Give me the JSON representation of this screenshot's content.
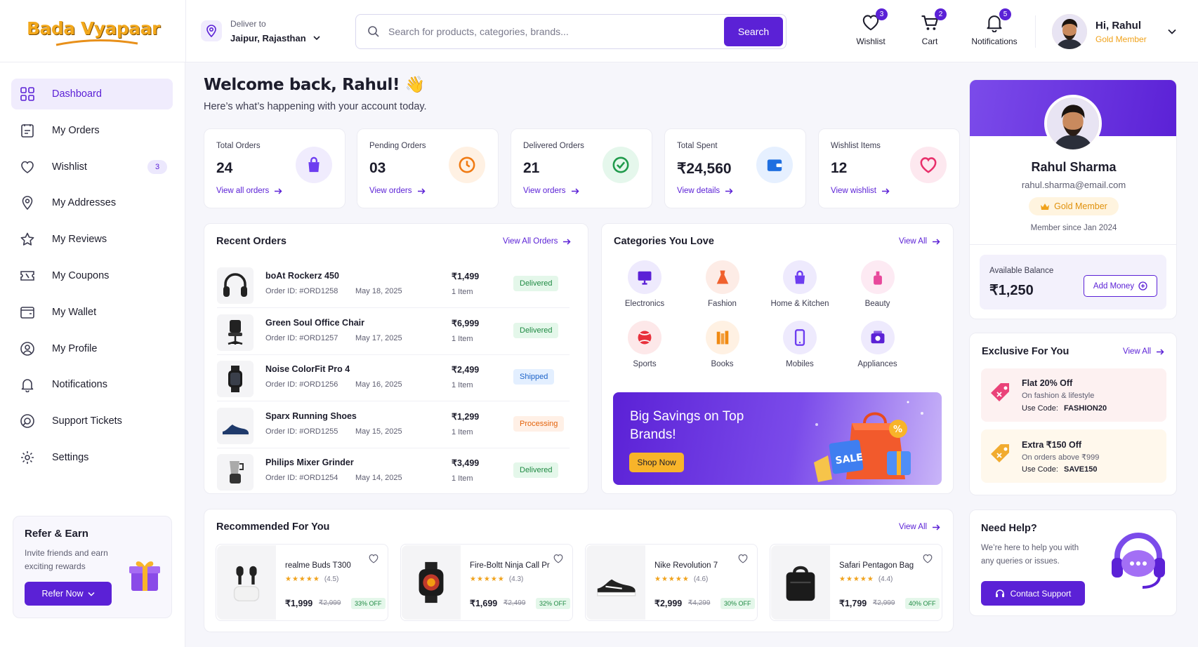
{
  "brand": {
    "logo_text": "Bada Vyapaar"
  },
  "deliver": {
    "label": "Deliver to",
    "location": "Jaipur, Rajasthan"
  },
  "search": {
    "placeholder": "Search for products, categories, brands...",
    "button": "Search"
  },
  "header_icons": [
    {
      "label": "Wishlist",
      "badge": "3",
      "icon": "heart-icon"
    },
    {
      "label": "Cart",
      "badge": "2",
      "icon": "cart-icon"
    },
    {
      "label": "Notifications",
      "badge": "5",
      "icon": "bell-icon"
    }
  ],
  "user": {
    "greeting": "Hi, Rahul",
    "tier": "Gold Member"
  },
  "sidebar": {
    "items": [
      {
        "label": "Dashboard",
        "icon": "grid-icon",
        "active": true
      },
      {
        "label": "My Orders",
        "icon": "orders-icon"
      },
      {
        "label": "Wishlist",
        "icon": "heart-icon",
        "count": "3"
      },
      {
        "label": "My Addresses",
        "icon": "location-pin-icon"
      },
      {
        "label": "My Reviews",
        "icon": "star-icon"
      },
      {
        "label": "My Coupons",
        "icon": "coupon-icon"
      },
      {
        "label": "My Wallet",
        "icon": "wallet-icon"
      },
      {
        "label": "My Profile",
        "icon": "user-icon"
      },
      {
        "label": "Notifications",
        "icon": "bell-icon"
      },
      {
        "label": "Support Tickets",
        "icon": "support-icon"
      },
      {
        "label": "Settings",
        "icon": "settings-icon"
      }
    ],
    "refer": {
      "title": "Refer & Earn",
      "text": "Invite friends and earn exciting rewards",
      "button": "Refer Now"
    }
  },
  "welcome": {
    "title": "Welcome back, Rahul! 👋",
    "subtitle": "Here’s what’s happening with your account today."
  },
  "stats": [
    {
      "label": "Total Orders",
      "value": "24",
      "link": "View all orders",
      "icon": "bag-icon",
      "color": "#6d3df0",
      "bg": "#f0ecfd"
    },
    {
      "label": "Pending Orders",
      "value": "03",
      "link": "View orders",
      "icon": "clock-icon",
      "color": "#f07a12",
      "bg": "#fff1e3"
    },
    {
      "label": "Delivered Orders",
      "value": "21",
      "link": "View orders",
      "icon": "check-circle-icon",
      "color": "#1f9a4b",
      "bg": "#e5f7ec"
    },
    {
      "label": "Total Spent",
      "value": "₹24,560",
      "link": "View details",
      "icon": "wallet-icon",
      "color": "#1f6fe0",
      "bg": "#e6f0ff"
    },
    {
      "label": "Wishlist Items",
      "value": "12",
      "link": "View wishlist",
      "icon": "heart-icon",
      "color": "#e8306b",
      "bg": "#fde8ef"
    }
  ],
  "recent_orders": {
    "title": "Recent Orders",
    "view_all": "View All Orders",
    "orders": [
      {
        "name": "boAt Rockerz 450",
        "id": "Order ID: #ORD1258",
        "date": "May 18, 2025",
        "price": "₹1,499",
        "qty": "1 Item",
        "status": "Delivered",
        "kind": "d",
        "icon": "headphones-icon"
      },
      {
        "name": "Green Soul Office Chair",
        "id": "Order ID: #ORD1257",
        "date": "May 17, 2025",
        "price": "₹6,999",
        "qty": "1 Item",
        "status": "Delivered",
        "kind": "d",
        "icon": "chair-icon"
      },
      {
        "name": "Noise ColorFit Pro 4",
        "id": "Order ID: #ORD1256",
        "date": "May 16, 2025",
        "price": "₹2,499",
        "qty": "1 Item",
        "status": "Shipped",
        "kind": "s",
        "icon": "watch-icon"
      },
      {
        "name": "Sparx Running Shoes",
        "id": "Order ID: #ORD1255",
        "date": "May 15, 2025",
        "price": "₹1,299",
        "qty": "1 Item",
        "status": "Processing",
        "kind": "p",
        "icon": "shoe-icon"
      },
      {
        "name": "Philips Mixer Grinder",
        "id": "Order ID: #ORD1254",
        "date": "May 14, 2025",
        "price": "₹3,499",
        "qty": "1 Item",
        "status": "Delivered",
        "kind": "d",
        "icon": "mixer-icon"
      }
    ]
  },
  "categories": {
    "title": "Categories You Love",
    "view_all": "View All",
    "items": [
      {
        "label": "Electronics",
        "icon": "monitor-icon",
        "color": "#5b21d6",
        "bg": "#eeeafd"
      },
      {
        "label": "Fashion",
        "icon": "dress-icon",
        "color": "#f0612d",
        "bg": "#fdece6"
      },
      {
        "label": "Home & Kitchen",
        "icon": "lock-bag-icon",
        "color": "#6d3df0",
        "bg": "#eeeafd"
      },
      {
        "label": "Beauty",
        "icon": "perfume-icon",
        "color": "#e8489b",
        "bg": "#fdeaf3"
      },
      {
        "label": "Sports",
        "icon": "ball-icon",
        "color": "#e8303b",
        "bg": "#fde8e9"
      },
      {
        "label": "Books",
        "icon": "books-icon",
        "color": "#f08a12",
        "bg": "#fff1e3"
      },
      {
        "label": "Mobiles",
        "icon": "mobile-icon",
        "color": "#6d3df0",
        "bg": "#eeeafd"
      },
      {
        "label": "Appliances",
        "icon": "appliance-icon",
        "color": "#5b21d6",
        "bg": "#eeeafd"
      }
    ]
  },
  "promo": {
    "title": "Big Savings on Top Brands!",
    "button": "Shop Now",
    "bag_text": "SALE"
  },
  "recommended": {
    "title": "Recommended For You",
    "view_all": "View All",
    "items": [
      {
        "name": "realme Buds T300",
        "rating": "(4.5)",
        "price": "₹1,999",
        "old": "₹2,999",
        "off": "33% OFF",
        "icon": "earbuds-icon"
      },
      {
        "name": "Fire-Boltt Ninja Call Pr",
        "rating": "(4.3)",
        "price": "₹1,699",
        "old": "₹2,499",
        "off": "32% OFF",
        "icon": "smartwatch-icon"
      },
      {
        "name": "Nike Revolution 7",
        "rating": "(4.6)",
        "price": "₹2,999",
        "old": "₹4,299",
        "off": "30% OFF",
        "icon": "sneaker-icon"
      },
      {
        "name": "Safari Pentagon Bag",
        "rating": "(4.4)",
        "price": "₹1,799",
        "old": "₹2,999",
        "off": "40% OFF",
        "icon": "backpack-icon"
      }
    ]
  },
  "profile": {
    "name": "Rahul Sharma",
    "email": "rahul.sharma@email.com",
    "tier": "Gold Member",
    "member_since": "Member since  Jan 2024",
    "balance_label": "Available Balance",
    "balance": "₹1,250",
    "add_money": "Add Money"
  },
  "exclusive": {
    "title": "Exclusive For You",
    "view_all": "View All",
    "offers": [
      {
        "title": "Flat 20% Off",
        "desc": "On fashion & lifestyle",
        "code_label": "Use Code:",
        "code": "FASHION20",
        "bg": "#fdf1f1",
        "color": "#e8306b",
        "icon": "tag-icon"
      },
      {
        "title": "Extra ₹150 Off",
        "desc": "On orders above ₹999",
        "code_label": "Use Code:",
        "code": "SAVE150",
        "bg": "#fff8ec",
        "color": "#f0a21b",
        "icon": "tag-icon"
      }
    ]
  },
  "help": {
    "title": "Need Help?",
    "text": "We’re here to help you with any queries or issues.",
    "button": "Contact Support"
  }
}
